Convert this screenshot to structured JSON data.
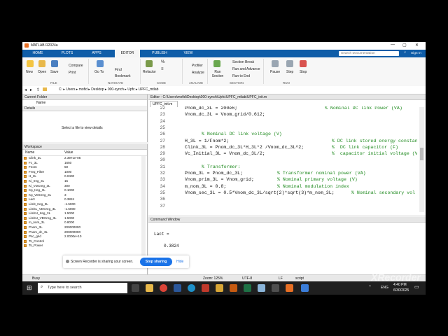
{
  "window": {
    "title": "MATLAB R2024a"
  },
  "tabs": [
    "HOME",
    "PLOTS",
    "APPS",
    "EDITOR",
    "PUBLISH",
    "VIEW"
  ],
  "search": {
    "placeholder": "Search Documentation"
  },
  "sign_in": "Sign In",
  "ribbon": {
    "new": "New",
    "open": "Open",
    "save": "Save",
    "compare": "Compare",
    "print": "Print",
    "goto": "Go To",
    "find": "Find",
    "bookmark": "Bookmark",
    "refactor": "Refactor",
    "profiler": "Profiler",
    "analyze": "Analyze",
    "run_section": "Run Section",
    "section_break": "Section Break",
    "run_advance": "Run and Advance",
    "run_to_end": "Run to End",
    "pause": "Pause",
    "step": "Step",
    "stop": "Stop",
    "groups": {
      "file": "FILE",
      "navigate": "NAVIGATE",
      "code": "CODE",
      "analyze": "ANALYZE",
      "section": "SECTION",
      "run": "RUN"
    }
  },
  "address": [
    "C:",
    "Users",
    "mofid",
    "Desktop",
    "000-synch",
    "Upfc",
    "UPFC_mtlab"
  ],
  "current_folder": {
    "title": "Current Folder",
    "col_name": "Name",
    "details": "Details",
    "empty": "Select a file to view details"
  },
  "workspace": {
    "title": "Workspace",
    "col_name": "Name",
    "col_value": "Value",
    "rows": [
      {
        "name": "Clink_3L",
        "value": "2.3971e-05"
      },
      {
        "name": "Fc_3L",
        "value": "1650"
      },
      {
        "name": "Fnom",
        "value": "50"
      },
      {
        "name": "Freq_Filter",
        "value": "1000"
      },
      {
        "name": "H_3L",
        "value": "0.0400"
      },
      {
        "name": "Ki_Ireg_3L",
        "value": "15"
      },
      {
        "name": "Ki_VDCreg_3L",
        "value": "300"
      },
      {
        "name": "Kp_Ireg_3L",
        "value": "0.1000"
      },
      {
        "name": "Kp_VDCreg_3L",
        "value": "3"
      },
      {
        "name": "Lact",
        "value": "0.3824"
      },
      {
        "name": "Limit_Ireg_3L",
        "value": "-1.5000"
      },
      {
        "name": "LimitL_VDCreg_3L",
        "value": "-1.5000"
      },
      {
        "name": "LimitU_Ireg_3L",
        "value": "1.5000"
      },
      {
        "name": "LimitU_VDCreg_3L",
        "value": "1.5000"
      },
      {
        "name": "m_nom_3L",
        "value": "0.8000"
      },
      {
        "name": "Pnom_3L",
        "value": "200000000"
      },
      {
        "name": "Pnom_dc_3L",
        "value": "200000000"
      },
      {
        "name": "Psc_grid",
        "value": "2.0000e+10"
      },
      {
        "name": "Ts_Control",
        "value": ""
      },
      {
        "name": "Ts_Power",
        "value": ""
      }
    ]
  },
  "editor": {
    "title": "Editor - C:\\Users\\mofid\\Desktop\\000-synch\\Upfc\\UPFC_mtlab\\UPFC_init.m",
    "file_tab": "UPFC_init.m",
    "lines": [
      {
        "n": "22",
        "code": "Pnom_dc_3L = 200e6;",
        "comment": "% Nominal DC link Power (VA)"
      },
      {
        "n": "23",
        "code": "Vnom_dc_3L = Vnom_grid/0.612;",
        "comment": ""
      },
      {
        "n": "24",
        "code": "",
        "comment": ""
      },
      {
        "n": "25",
        "code": "",
        "comment": ""
      },
      {
        "n": "26",
        "code": "",
        "comment": "% Nominal DC link voltage (V)"
      },
      {
        "n": "27",
        "code": "H_3L = 1/Fnom*2;",
        "comment": "% DC link stored energy constant(s)"
      },
      {
        "n": "28",
        "code": "Clink_3L = Pnom_dc_3L*H_3L*2 /Vnom_dc_3L^2;",
        "comment": "%  DC link capacitor (F)"
      },
      {
        "n": "29",
        "code": "Vc_Initial_3L = Vnom_dc_3L/2;",
        "comment": "%  capacitor initial voltage (V)"
      },
      {
        "n": "30",
        "code": "",
        "comment": ""
      },
      {
        "n": "31",
        "code": "",
        "comment": "% Transformer:"
      },
      {
        "n": "32",
        "code": "Pnom_3L = Pnom_dc_3L;",
        "comment": "% Transformer nominal power (VA)"
      },
      {
        "n": "33",
        "code": "Vnom_prim_3L = Vnom_grid;",
        "comment": "% Nominal primary voltage (V)"
      },
      {
        "n": "34",
        "code": "m_nom_3L = 0.8;",
        "comment": "% Nominal modulation index"
      },
      {
        "n": "35",
        "code": "Vnom_sec_3L = 0.5*Vnom_dc_3L/sqrt(2)*sqrt(3)*m_nom_3L;",
        "comment": "% Nominal secondary vol"
      },
      {
        "n": "36",
        "code": "",
        "comment": ""
      },
      {
        "n": "37",
        "code": "",
        "comment": ""
      }
    ]
  },
  "command_window": {
    "title": "Command Window",
    "var": "Lact =",
    "value": "0.3824"
  },
  "share_banner": {
    "text": "Screen Recorder is sharing your screen.",
    "stop": "Stop sharing",
    "hide": "Hide"
  },
  "status": {
    "busy": "Busy",
    "zoom": "Zoom: 125%",
    "encoding": "UTF-8",
    "eol": "LF",
    "type": "script"
  },
  "taskbar": {
    "search": "Type here to search",
    "time": "4:40 PM",
    "date": "6/30/2025",
    "lang": "ENG"
  },
  "watermark": "XRecorder"
}
